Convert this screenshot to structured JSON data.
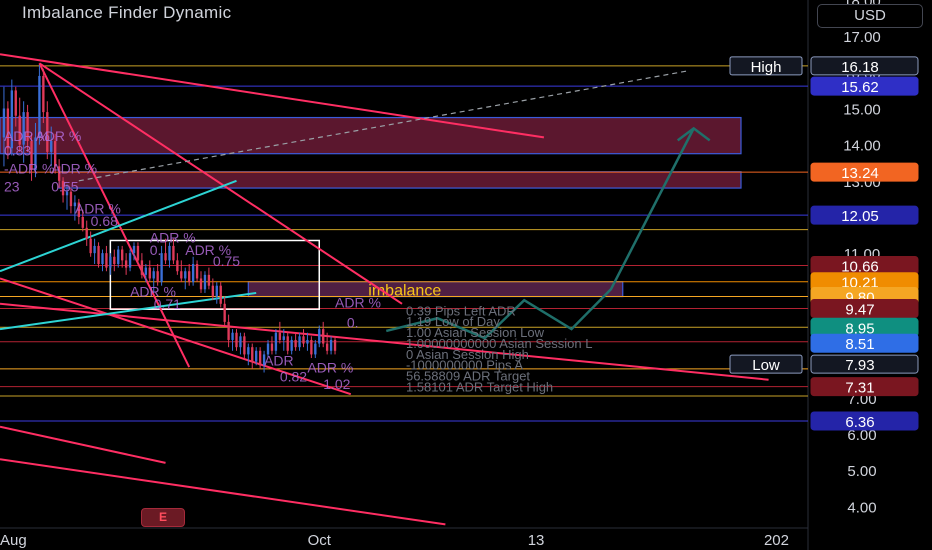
{
  "title": "Imbalance Finder Dynamic",
  "currency": "USD",
  "earnings_badge": "E",
  "chart_data": {
    "type": "candlestick",
    "title": "Imbalance Finder Dynamic",
    "y_range": [
      3.4,
      18.0
    ],
    "y_ticks": [
      "18.00",
      "17.00",
      "16.00",
      "15.00",
      "14.00",
      "13.00",
      "12.00",
      "11.00",
      "10.00",
      "9.00",
      "8.00",
      "7.00",
      "6.00",
      "5.00",
      "4.00"
    ],
    "x_ticks": [
      {
        "label": "Aug",
        "x": 0
      },
      {
        "label": "Oct",
        "x": 76
      },
      {
        "label": "13",
        "x": 131
      },
      {
        "label": "202",
        "x": 192
      }
    ],
    "x_range": [
      -5,
      200
    ],
    "price_tags": [
      {
        "value": 16.18,
        "label": "16.18",
        "color": "#131722",
        "border": "#8c9bbf",
        "side_label": "High"
      },
      {
        "value": 15.62,
        "label": "15.62",
        "color": "#2f2fc6"
      },
      {
        "value": 13.24,
        "label": "13.24",
        "color": "#f26522"
      },
      {
        "value": 12.05,
        "label": "12.05",
        "color": "#2424a8"
      },
      {
        "value": 10.66,
        "label": "10.66",
        "color": "#7a1620"
      },
      {
        "value": 10.21,
        "label": "10.21",
        "color": "#f08c00"
      },
      {
        "value": 9.8,
        "label": "9.80",
        "color": "#f5a623"
      },
      {
        "value": 9.47,
        "label": "9.47",
        "color": "#7a1620"
      },
      {
        "value": 8.95,
        "label": "8.95",
        "color": "#0f8f80"
      },
      {
        "value": 8.51,
        "label": "8.51",
        "color": "#2f6ee6"
      },
      {
        "value": 7.93,
        "label": "7.93",
        "color": "#131722",
        "border": "#8c9bbf",
        "side_label": "Low"
      },
      {
        "value": 7.31,
        "label": "7.31",
        "color": "#7a1620"
      },
      {
        "value": 6.36,
        "label": "6.36",
        "color": "#2424a8"
      }
    ],
    "horizontal_lines": [
      {
        "value": 16.18,
        "color": "#c9a227"
      },
      {
        "value": 15.62,
        "color": "#3b3be0"
      },
      {
        "value": 13.24,
        "color": "#f26522"
      },
      {
        "value": 12.05,
        "color": "#3b3be0"
      },
      {
        "value": 11.65,
        "color": "#c9a227"
      },
      {
        "value": 10.66,
        "color": "#b32232"
      },
      {
        "value": 10.21,
        "color": "#f08c00"
      },
      {
        "value": 9.8,
        "color": "#f5a623"
      },
      {
        "value": 9.47,
        "color": "#b32232"
      },
      {
        "value": 8.95,
        "color": "#c9a227"
      },
      {
        "value": 8.55,
        "color": "#b32232"
      },
      {
        "value": 7.8,
        "color": "#f5a623"
      },
      {
        "value": 7.31,
        "color": "#b32232"
      },
      {
        "value": 7.05,
        "color": "#c9a227"
      },
      {
        "value": 6.36,
        "color": "#3b3be0"
      }
    ],
    "imbalance_zones": [
      {
        "x0": -5,
        "x1": 183,
        "y0": 13.75,
        "y1": 14.75,
        "color": "#7a1f3d"
      },
      {
        "x0": 10,
        "x1": 183,
        "y0": 12.8,
        "y1": 13.25,
        "color": "#7a1f3d"
      },
      {
        "x0": 58,
        "x1": 153,
        "y0": 9.8,
        "y1": 10.21,
        "color": "#6a2a5a"
      }
    ],
    "imbalance_label": "imbalance",
    "box": {
      "x0": 23,
      "x1": 76,
      "y0": 9.45,
      "y1": 11.35
    },
    "trend_lines": [
      {
        "x0": 5,
        "y0": 16.25,
        "x1": 43,
        "y1": 7.85,
        "color": "#ff2e63"
      },
      {
        "x0": -5,
        "y0": 16.5,
        "x1": 133,
        "y1": 14.2,
        "color": "#ff2e63"
      },
      {
        "x0": 5,
        "y0": 16.25,
        "x1": 97,
        "y1": 9.6,
        "color": "#ff2e63"
      },
      {
        "x0": -5,
        "y0": 10.3,
        "x1": 84,
        "y1": 7.1,
        "color": "#ff2e63"
      },
      {
        "x0": -5,
        "y0": 9.6,
        "x1": 190,
        "y1": 7.5,
        "color": "#ff2e63"
      },
      {
        "x0": -5,
        "y0": 6.2,
        "x1": 37,
        "y1": 5.2,
        "color": "#ff2e63"
      },
      {
        "x0": -5,
        "y0": 5.3,
        "x1": 108,
        "y1": 3.5,
        "color": "#ff2e63"
      },
      {
        "x0": -5,
        "y0": 10.5,
        "x1": 55,
        "y1": 13.0,
        "color": "#2dd4d4"
      },
      {
        "x0": -5,
        "y0": 8.9,
        "x1": 60,
        "y1": 9.9,
        "color": "#2dd4d4"
      }
    ],
    "dashed_projection": {
      "x0": 15,
      "y0": 13.0,
      "x1": 170,
      "y1": 16.05
    },
    "projection_path": [
      [
        93,
        8.85
      ],
      [
        106,
        9.2
      ],
      [
        118,
        8.65
      ],
      [
        128,
        9.7
      ],
      [
        140,
        8.9
      ],
      [
        150,
        10.0
      ],
      [
        171,
        14.45
      ]
    ],
    "candles": [
      [
        -4,
        14.2,
        15.6,
        13.4,
        15.0
      ],
      [
        -3,
        15.0,
        15.2,
        13.6,
        13.9
      ],
      [
        -2,
        13.9,
        15.8,
        13.7,
        15.5
      ],
      [
        -1,
        15.5,
        15.6,
        14.5,
        14.8
      ],
      [
        0,
        14.8,
        15.3,
        13.8,
        14.0
      ],
      [
        1,
        14.0,
        15.2,
        13.5,
        14.9
      ],
      [
        2,
        14.9,
        15.1,
        13.8,
        14.1
      ],
      [
        3,
        14.1,
        14.3,
        13.0,
        13.3
      ],
      [
        4,
        13.3,
        14.6,
        13.1,
        14.2
      ],
      [
        5,
        14.2,
        16.2,
        14.0,
        15.9
      ],
      [
        6,
        15.9,
        16.1,
        14.6,
        14.9
      ],
      [
        7,
        14.9,
        15.2,
        13.6,
        13.8
      ],
      [
        8,
        13.8,
        14.5,
        13.4,
        14.1
      ],
      [
        9,
        14.1,
        14.3,
        13.2,
        13.4
      ],
      [
        10,
        13.4,
        13.6,
        12.8,
        13.0
      ],
      [
        11,
        13.0,
        13.1,
        12.4,
        12.6
      ],
      [
        12,
        12.6,
        12.9,
        12.2,
        12.7
      ],
      [
        13,
        12.7,
        12.8,
        12.1,
        12.3
      ],
      [
        14,
        12.3,
        12.6,
        11.9,
        12.4
      ],
      [
        15,
        12.4,
        12.5,
        11.8,
        12.0
      ],
      [
        16,
        12.0,
        12.2,
        11.6,
        11.7
      ],
      [
        17,
        11.7,
        11.9,
        11.2,
        11.4
      ],
      [
        18,
        11.4,
        11.6,
        10.9,
        11.0
      ],
      [
        19,
        11.0,
        11.4,
        10.7,
        11.2
      ],
      [
        20,
        11.2,
        11.3,
        10.6,
        10.7
      ],
      [
        21,
        10.7,
        11.1,
        10.5,
        11.0
      ],
      [
        22,
        11.0,
        11.2,
        10.5,
        10.6
      ],
      [
        23,
        10.6,
        11.0,
        10.4,
        10.9
      ],
      [
        24,
        10.9,
        11.1,
        10.5,
        10.7
      ],
      [
        25,
        10.7,
        11.2,
        10.6,
        11.1
      ],
      [
        26,
        11.1,
        11.2,
        10.6,
        10.8
      ],
      [
        27,
        10.8,
        11.0,
        10.4,
        10.6
      ],
      [
        28,
        10.6,
        11.1,
        10.5,
        11.0
      ],
      [
        29,
        11.0,
        11.3,
        10.8,
        11.2
      ],
      [
        30,
        11.2,
        11.3,
        10.7,
        10.8
      ],
      [
        31,
        10.8,
        11.0,
        10.3,
        10.4
      ],
      [
        32,
        10.4,
        10.7,
        10.2,
        10.6
      ],
      [
        33,
        10.6,
        10.8,
        10.2,
        10.3
      ],
      [
        34,
        10.3,
        10.6,
        9.9,
        10.5
      ],
      [
        35,
        10.5,
        10.7,
        10.1,
        10.2
      ],
      [
        36,
        10.2,
        11.2,
        10.1,
        11.0
      ],
      [
        37,
        11.0,
        11.4,
        10.7,
        10.8
      ],
      [
        38,
        10.8,
        11.3,
        10.6,
        11.2
      ],
      [
        39,
        11.2,
        11.4,
        10.7,
        10.8
      ],
      [
        40,
        10.8,
        11.0,
        10.4,
        10.5
      ],
      [
        41,
        10.5,
        10.8,
        10.2,
        10.3
      ],
      [
        42,
        10.3,
        10.6,
        10.0,
        10.5
      ],
      [
        43,
        10.5,
        10.7,
        10.1,
        10.2
      ],
      [
        44,
        10.2,
        10.9,
        10.1,
        10.7
      ],
      [
        45,
        10.7,
        10.8,
        10.2,
        10.3
      ],
      [
        46,
        10.3,
        10.5,
        9.9,
        10.0
      ],
      [
        47,
        10.0,
        10.5,
        9.9,
        10.4
      ],
      [
        48,
        10.4,
        10.6,
        10.0,
        10.1
      ],
      [
        49,
        10.1,
        10.3,
        9.7,
        9.8
      ],
      [
        50,
        9.8,
        10.2,
        9.6,
        10.1
      ],
      [
        51,
        10.1,
        10.2,
        9.5,
        9.6
      ],
      [
        52,
        9.6,
        9.8,
        9.0,
        9.1
      ],
      [
        53,
        9.1,
        9.3,
        8.4,
        8.6
      ],
      [
        54,
        8.6,
        8.9,
        8.3,
        8.8
      ],
      [
        55,
        8.8,
        8.9,
        8.3,
        8.4
      ],
      [
        56,
        8.4,
        8.8,
        8.2,
        8.7
      ],
      [
        57,
        8.7,
        8.8,
        8.1,
        8.2
      ],
      [
        58,
        8.2,
        8.5,
        7.9,
        8.4
      ],
      [
        59,
        8.4,
        8.5,
        7.8,
        8.0
      ],
      [
        60,
        8.0,
        8.4,
        7.9,
        8.3
      ],
      [
        61,
        8.3,
        8.4,
        7.8,
        7.9
      ],
      [
        62,
        7.9,
        8.3,
        7.7,
        8.2
      ],
      [
        63,
        8.2,
        8.6,
        8.1,
        8.5
      ],
      [
        64,
        8.5,
        8.7,
        8.2,
        8.3
      ],
      [
        65,
        8.3,
        8.9,
        8.2,
        8.8
      ],
      [
        66,
        8.8,
        9.1,
        8.5,
        8.6
      ],
      [
        67,
        8.6,
        8.9,
        8.3,
        8.7
      ],
      [
        68,
        8.7,
        8.8,
        8.2,
        8.3
      ],
      [
        69,
        8.3,
        8.7,
        8.2,
        8.6
      ],
      [
        70,
        8.6,
        8.8,
        8.3,
        8.4
      ],
      [
        71,
        8.4,
        8.8,
        8.3,
        8.7
      ],
      [
        72,
        8.7,
        8.9,
        8.4,
        8.5
      ],
      [
        73,
        8.5,
        8.8,
        8.3,
        8.6
      ],
      [
        74,
        8.6,
        8.7,
        8.1,
        8.2
      ],
      [
        75,
        8.2,
        8.6,
        8.1,
        8.5
      ],
      [
        76,
        8.5,
        9.0,
        8.4,
        8.9
      ],
      [
        77,
        8.9,
        9.1,
        8.4,
        8.5
      ],
      [
        78,
        8.5,
        8.8,
        8.2,
        8.3
      ],
      [
        79,
        8.3,
        8.7,
        8.2,
        8.6
      ],
      [
        80,
        8.6,
        8.7,
        8.2,
        8.3
      ]
    ],
    "annotations": [
      {
        "text": "ADR %",
        "x": -4,
        "y": 14.1,
        "color": "#b06ad6"
      },
      {
        "text": "ADR %",
        "x": 4,
        "y": 14.1,
        "color": "#b06ad6"
      },
      {
        "text": "0.83",
        "x": -4,
        "y": 13.7,
        "color": "#b06ad6"
      },
      {
        "text": "-ADR %",
        "x": -4,
        "y": 13.2,
        "color": "#b06ad6"
      },
      {
        "text": "ADR %",
        "x": 8,
        "y": 13.2,
        "color": "#b06ad6"
      },
      {
        "text": "23",
        "x": -4,
        "y": 12.7,
        "color": "#b06ad6"
      },
      {
        "text": "0.55",
        "x": 8,
        "y": 12.7,
        "color": "#b06ad6"
      },
      {
        "text": "ADR %",
        "x": 14,
        "y": 12.1,
        "color": "#b06ad6"
      },
      {
        "text": "0.68",
        "x": 18,
        "y": 11.75,
        "color": "#b06ad6"
      },
      {
        "text": "ADR %",
        "x": 33,
        "y": 11.3,
        "color": "#b06ad6"
      },
      {
        "text": "0.",
        "x": 33,
        "y": 10.95,
        "color": "#b06ad6"
      },
      {
        "text": "ADR %",
        "x": 42,
        "y": 10.95,
        "color": "#b06ad6"
      },
      {
        "text": "0.75",
        "x": 49,
        "y": 10.65,
        "color": "#b06ad6"
      },
      {
        "text": "ADR %",
        "x": 28,
        "y": 9.8,
        "color": "#b06ad6"
      },
      {
        "text": "0.71",
        "x": 34,
        "y": 9.45,
        "color": "#b06ad6"
      },
      {
        "text": "ADR %",
        "x": 80,
        "y": 9.5,
        "color": "#b06ad6"
      },
      {
        "text": "0.",
        "x": 83,
        "y": 8.95,
        "color": "#b06ad6"
      },
      {
        "text": "ADR",
        "x": 62,
        "y": 7.9,
        "color": "#b06ad6"
      },
      {
        "text": "ADR %",
        "x": 73,
        "y": 7.7,
        "color": "#b06ad6"
      },
      {
        "text": "0.82",
        "x": 66,
        "y": 7.45,
        "color": "#b06ad6"
      },
      {
        "text": "1.02",
        "x": 77,
        "y": 7.25,
        "color": "#b06ad6"
      }
    ],
    "info_lines": [
      {
        "text": "0.39 Pips Left ADR",
        "x": 98,
        "y": 9.28
      },
      {
        "text": "1.19 Low of Day",
        "x": 98,
        "y": 8.98
      },
      {
        "text": "1.00 Asian Session Low",
        "x": 98,
        "y": 8.68
      },
      {
        "text": "1.00000000000 Asian Session L",
        "x": 98,
        "y": 8.38
      },
      {
        "text": "0 Asian Session High",
        "x": 98,
        "y": 8.08
      },
      {
        "text": "-1000000000 Pips A",
        "x": 98,
        "y": 7.78
      },
      {
        "text": "56.58809 ADR Target",
        "x": 98,
        "y": 7.48
      },
      {
        "text": "1.58101 ADR Target High",
        "x": 98,
        "y": 7.18
      }
    ],
    "grid": false,
    "legend": "none"
  }
}
